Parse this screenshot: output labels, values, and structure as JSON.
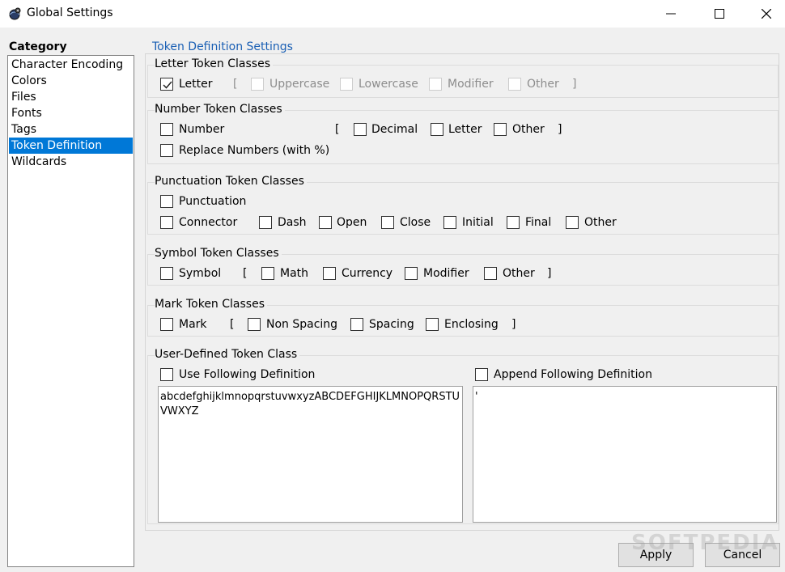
{
  "window": {
    "title": "Global Settings",
    "app_icon": "globe-gear-icon",
    "minimize_icon": "minimize-icon",
    "maximize_icon": "maximize-icon",
    "close_icon": "close-icon"
  },
  "sidebar": {
    "heading": "Category",
    "items": [
      {
        "label": "Character Encoding",
        "selected": false
      },
      {
        "label": "Colors",
        "selected": false
      },
      {
        "label": "Files",
        "selected": false
      },
      {
        "label": "Fonts",
        "selected": false
      },
      {
        "label": "Tags",
        "selected": false
      },
      {
        "label": "Token Definition",
        "selected": true
      },
      {
        "label": "Wildcards",
        "selected": false
      }
    ],
    "selected_color": "#0078d7"
  },
  "main": {
    "title": "Token Definition Settings",
    "letter": {
      "title": "Letter Token Classes",
      "letter": {
        "label": "Letter",
        "checked": true
      },
      "open_bracket": "[",
      "close_bracket": "]",
      "uppercase": {
        "label": "Uppercase",
        "checked": false,
        "enabled": false
      },
      "lowercase": {
        "label": "Lowercase",
        "checked": false,
        "enabled": false
      },
      "modifier": {
        "label": "Modifier",
        "checked": false,
        "enabled": false
      },
      "other": {
        "label": "Other",
        "checked": false,
        "enabled": false
      }
    },
    "number": {
      "title": "Number Token Classes",
      "number": {
        "label": "Number",
        "checked": false
      },
      "open_bracket": "[",
      "close_bracket": "]",
      "decimal": {
        "label": "Decimal",
        "checked": false
      },
      "letter": {
        "label": "Letter",
        "checked": false
      },
      "other": {
        "label": "Other",
        "checked": false
      },
      "replace": {
        "label": "Replace Numbers (with %)",
        "checked": false
      }
    },
    "punctuation": {
      "title": "Punctuation Token Classes",
      "punctuation": {
        "label": "Punctuation",
        "checked": false
      },
      "connector": {
        "label": "Connector",
        "checked": false
      },
      "dash": {
        "label": "Dash",
        "checked": false
      },
      "open": {
        "label": "Open",
        "checked": false
      },
      "close": {
        "label": "Close",
        "checked": false
      },
      "initial": {
        "label": "Initial",
        "checked": false
      },
      "final": {
        "label": "Final",
        "checked": false
      },
      "other": {
        "label": "Other",
        "checked": false
      }
    },
    "symbol": {
      "title": "Symbol Token Classes",
      "symbol": {
        "label": "Symbol",
        "checked": false
      },
      "open_bracket": "[",
      "close_bracket": "]",
      "math": {
        "label": "Math",
        "checked": false
      },
      "currency": {
        "label": "Currency",
        "checked": false
      },
      "modifier": {
        "label": "Modifier",
        "checked": false
      },
      "other": {
        "label": "Other",
        "checked": false
      }
    },
    "mark": {
      "title": "Mark Token Classes",
      "mark": {
        "label": "Mark",
        "checked": false
      },
      "open_bracket": "[",
      "close_bracket": "]",
      "non_spacing": {
        "label": "Non Spacing",
        "checked": false
      },
      "spacing": {
        "label": "Spacing",
        "checked": false
      },
      "enclosing": {
        "label": "Enclosing",
        "checked": false
      }
    },
    "user_defined": {
      "title": "User-Defined Token Class",
      "use_following": {
        "label": "Use Following Definition",
        "checked": false
      },
      "append_following": {
        "label": "Append Following Definition",
        "checked": false
      },
      "use_text": "abcdefghijklmnopqrstuvwxyzABCDEFGHIJKLMNOPQRSTUVWXYZ",
      "append_text": "'"
    }
  },
  "footer": {
    "apply_label": "Apply",
    "cancel_label": "Cancel",
    "watermark": "SOFTPEDIA"
  }
}
